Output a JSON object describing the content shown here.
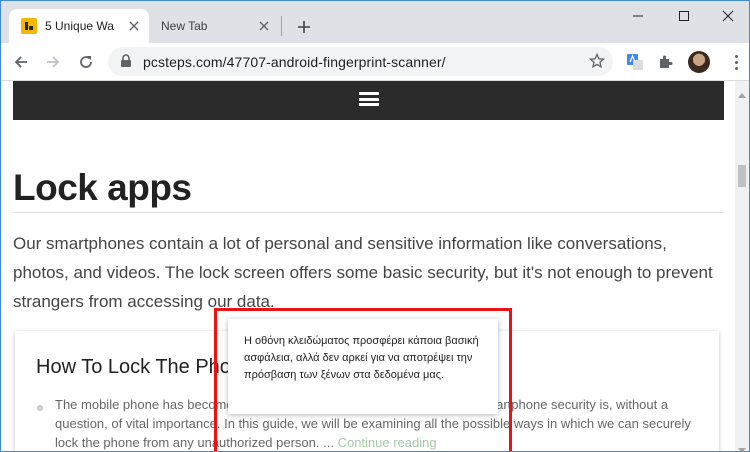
{
  "browser": {
    "tabs": [
      {
        "title": "5 Unique Wa",
        "active": true
      },
      {
        "title": "New Tab",
        "active": false
      }
    ],
    "url": "pcsteps.com/47707-android-fingerprint-scanner/"
  },
  "page": {
    "heading": "Lock apps",
    "paragraph": "Our smartphones contain a lot of personal and sensitive information like conversations, photos, and videos. The lock screen offers some basic security, but it's not enough to prevent strangers from accessing our data.",
    "card": {
      "title": "How To Lock The Phone",
      "text": "The mobile phone has become ... therefore, it's easy to conclude that our smartphone security is, without a question, of vital importance. In this guide, we will be examining all the possible ways in which we can securely lock the phone from any unauthorized person. ...",
      "continue_label": "Continue reading"
    }
  },
  "tooltip": {
    "text": "Η οθόνη κλειδώματος προσφέρει κάποια βασική ασφάλεια, αλλά δεν αρκεί για να αποτρέψει την πρόσβαση των ξένων στα δεδομένα μας."
  },
  "colors": {
    "highlight_border": "#e11111",
    "site_bar": "#2b2b2b",
    "favicon": "#f5b800"
  }
}
